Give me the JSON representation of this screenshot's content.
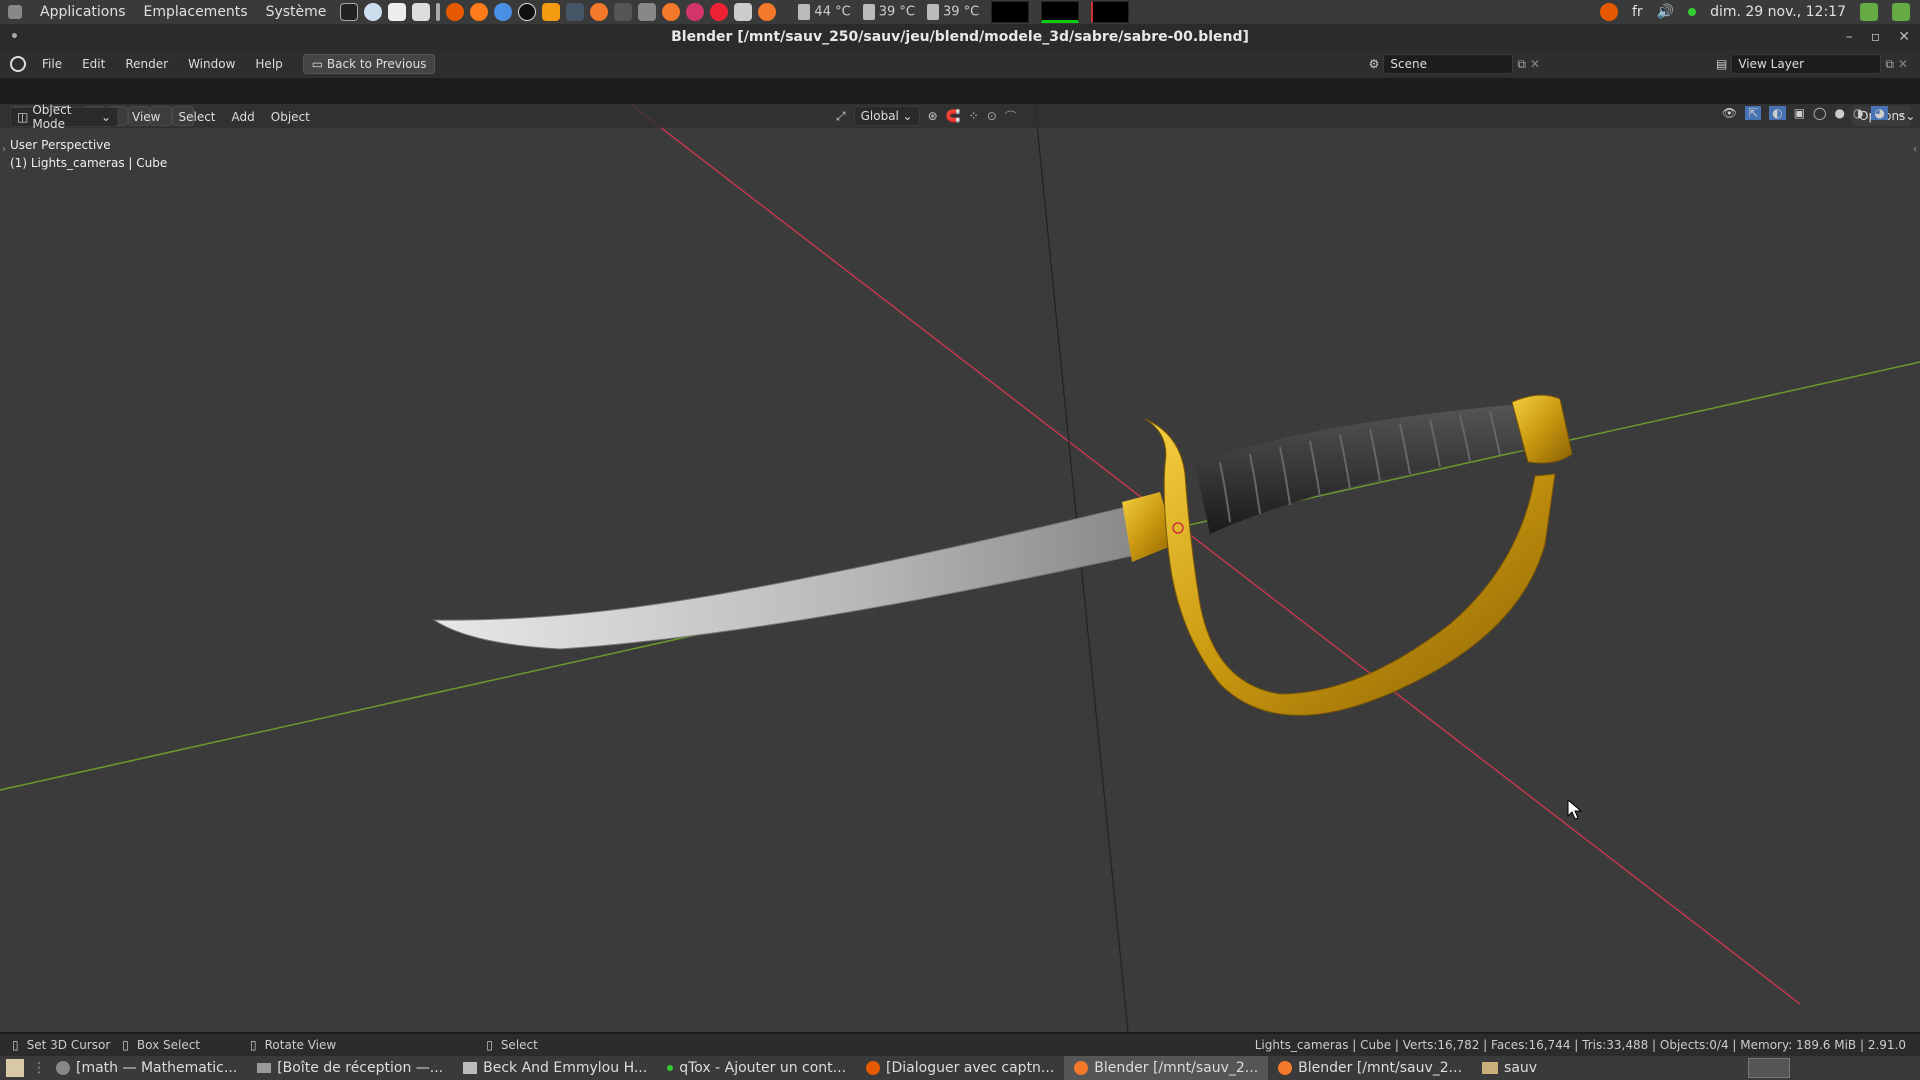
{
  "system_panel": {
    "menus": [
      "Applications",
      "Emplacements",
      "Système"
    ],
    "temps": [
      "44 °C",
      "39 °C",
      "39 °C"
    ],
    "lang": "fr",
    "datetime": "dim. 29 nov., 12:17"
  },
  "window": {
    "title": "Blender [/mnt/sauv_250/sauv/jeu/blend/modele_3d/sabre/sabre-00.blend]"
  },
  "topbar": {
    "menus": [
      "File",
      "Edit",
      "Render",
      "Window",
      "Help"
    ],
    "back_label": "Back to Previous",
    "scene": "Scene",
    "view_layer": "View Layer"
  },
  "header1": {
    "transform_orientation": "Global",
    "options_label": "Options"
  },
  "header2": {
    "mode": "Object Mode",
    "menus": [
      "View",
      "Select",
      "Add",
      "Object"
    ]
  },
  "viewport": {
    "perspective": "User Perspective",
    "context": "(1) Lights_cameras | Cube"
  },
  "statusbar": {
    "items": [
      "Set 3D Cursor",
      "Box Select",
      "Rotate View",
      "Select"
    ],
    "stats": "Lights_cameras | Cube | Verts:16,782 | Faces:16,744 | Tris:33,488 | Objects:0/4 | Memory: 189.6 MiB | 2.91.0"
  },
  "taskbar": {
    "tasks": [
      "[math — Mathematic...",
      "[Boîte de réception —...",
      "Beck And Emmylou H...",
      "qTox - Ajouter un cont...",
      "[Dialoguer avec captn...",
      "Blender [/mnt/sauv_2...",
      "Blender [/mnt/sauv_2...",
      "sauv"
    ]
  }
}
